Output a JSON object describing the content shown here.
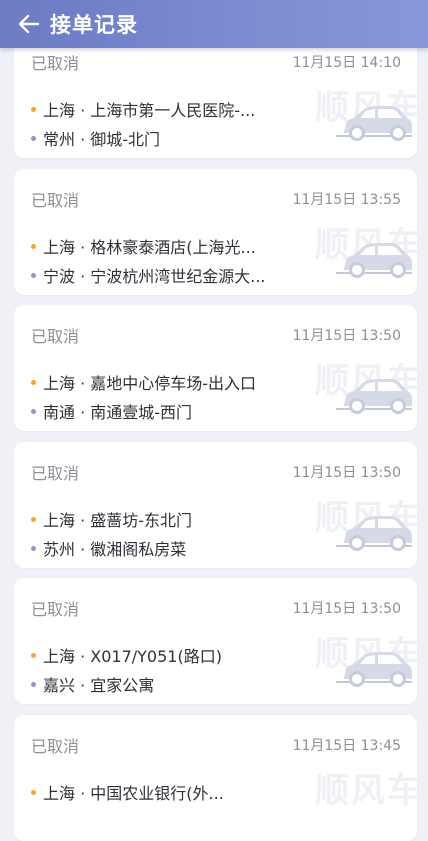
{
  "header": {
    "title": "接单记录",
    "back_icon": "arrow-left-icon"
  },
  "watermark_text": "顺风车",
  "colors": {
    "header": "#7788cf",
    "from_dot": "#f5a623",
    "to_dot": "#8a9bc0",
    "background": "#eff1f6"
  },
  "records": [
    {
      "status": "已取消",
      "time": "11月15日 14:10",
      "from": "上海 · 上海市第一人民医院-...",
      "to": "常州 · 御城-北门"
    },
    {
      "status": "已取消",
      "time": "11月15日 13:55",
      "from": "上海 · 格林豪泰酒店(上海光...",
      "to": "宁波 · 宁波杭州湾世纪金源大..."
    },
    {
      "status": "已取消",
      "time": "11月15日 13:50",
      "from": "上海 · 嘉地中心停车场-出入口",
      "to": "南通 · 南通壹城-西门"
    },
    {
      "status": "已取消",
      "time": "11月15日 13:50",
      "from": "上海 · 盛蔷坊-东北门",
      "to": "苏州 · 徽湘阁私房菜"
    },
    {
      "status": "已取消",
      "time": "11月15日 13:50",
      "from": "上海 · X017/Y051(路口)",
      "to": "嘉兴 · 宜家公寓"
    },
    {
      "status": "已取消",
      "time": "11月15日 13:45",
      "from": "上海 · 中国农业银行(外...",
      "to": ""
    }
  ]
}
